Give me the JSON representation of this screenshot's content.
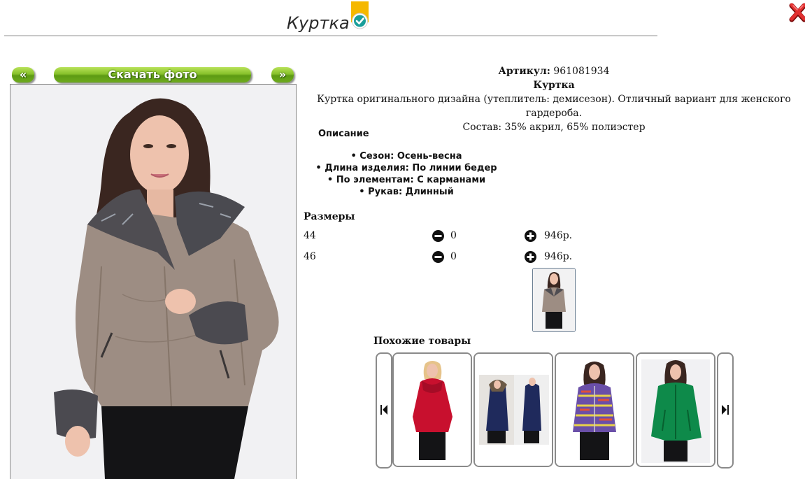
{
  "header": {
    "title": "Куртка",
    "accent_color": "#f5b800",
    "check_color": "#1a9e9a"
  },
  "photo_panel": {
    "prev_label": "«",
    "download_label": "Скачать фото",
    "next_label": "»"
  },
  "product": {
    "article_label": "Артикул:",
    "article_value": "961081934",
    "name": "Куртка",
    "description_line1": "Куртка оригинального дизайна (утеплитель: демисезон). Отличный вариант для женского гардероба.",
    "description_line2": "Состав: 35% акрил, 65% полиэстер"
  },
  "description": {
    "title": "Описание",
    "features": [
      "Сезон: Осень-весна",
      "Длина изделия: По линии бедер",
      "По элементам: С карманами",
      "Рукав: Длинный"
    ]
  },
  "sizes": {
    "title": "Размеры",
    "rows": [
      {
        "size": "44",
        "qty": "0",
        "price": "946р."
      },
      {
        "size": "46",
        "qty": "0",
        "price": "946р."
      }
    ]
  },
  "similar": {
    "title": "Похожие товары",
    "items": [
      {
        "color": "#c8102e"
      },
      {
        "color": "#1f2a5c"
      },
      {
        "color": "#6a4fa8"
      },
      {
        "color": "#0e8a4a"
      }
    ]
  }
}
